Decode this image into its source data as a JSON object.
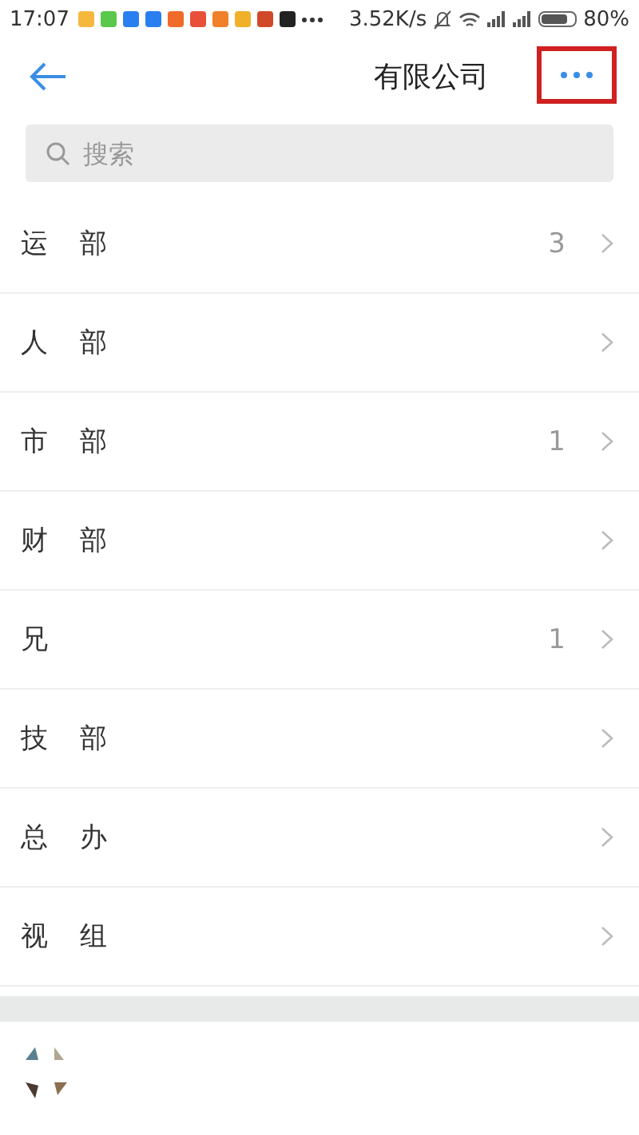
{
  "status_bar": {
    "time": "17:07",
    "speed": "3.52K/s",
    "battery": "80%"
  },
  "header": {
    "title": "有限公司"
  },
  "search": {
    "placeholder": "搜索"
  },
  "departments": [
    {
      "name_start": "运",
      "name_end": "部",
      "count": "3"
    },
    {
      "name_start": "人",
      "name_end": "部"
    },
    {
      "name_start": "市",
      "name_end": "部",
      "count": "1"
    },
    {
      "name_start": "财",
      "name_end": "部"
    },
    {
      "name_start": "兄",
      "count": "1"
    },
    {
      "name_start": "技",
      "name_end": "部"
    },
    {
      "name_start": "总",
      "name_end": "办"
    },
    {
      "name_start": "视",
      "name_end": "组"
    }
  ]
}
